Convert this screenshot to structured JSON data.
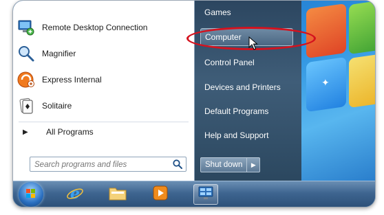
{
  "start_menu": {
    "programs": [
      {
        "label": "Remote Desktop Connection",
        "icon": "remote-desktop-icon"
      },
      {
        "label": "Magnifier",
        "icon": "magnifier-icon"
      },
      {
        "label": "Express Internal",
        "icon": "express-internal-icon"
      },
      {
        "label": "Solitaire",
        "icon": "solitaire-icon"
      }
    ],
    "all_programs_label": "All Programs",
    "search_placeholder": "Search programs and files",
    "right_items": [
      {
        "label": "Games"
      },
      {
        "label": "Computer"
      },
      {
        "label": "Control Panel"
      },
      {
        "label": "Devices and Printers"
      },
      {
        "label": "Default Programs"
      },
      {
        "label": "Help and Support"
      }
    ],
    "shutdown_label": "Shut down",
    "highlighted_item": "Computer",
    "highlight_color": "#d4121e"
  },
  "taskbar": {
    "items": [
      {
        "icon": "start-orb-icon"
      },
      {
        "icon": "internet-explorer-icon"
      },
      {
        "icon": "file-explorer-icon"
      },
      {
        "icon": "media-player-icon"
      },
      {
        "icon": "remote-desktop-taskbar-icon"
      }
    ]
  }
}
